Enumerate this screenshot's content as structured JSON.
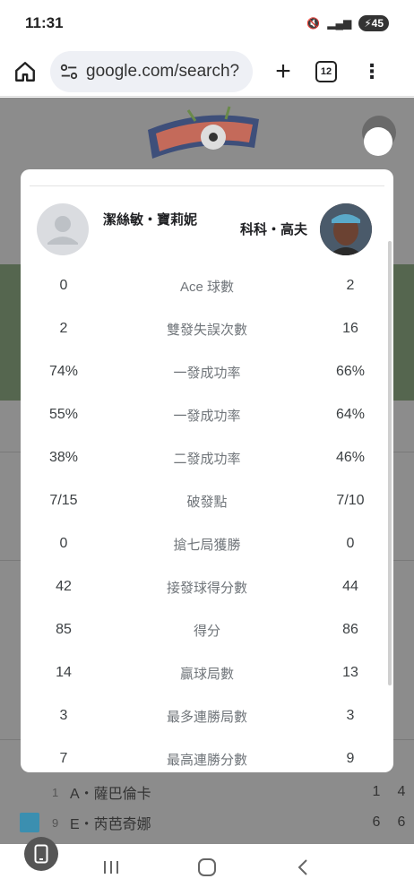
{
  "status_bar": {
    "time": "11:31",
    "battery": "45"
  },
  "browser": {
    "url": "google.com/search?",
    "tab_count": "12"
  },
  "background": {
    "list": [
      {
        "num": "1",
        "name": "A・薩巴倫卡",
        "s1": "1",
        "s2": "4"
      },
      {
        "num": "9",
        "name": "E・芮芭奇娜",
        "s1": "6",
        "s2": "6"
      }
    ]
  },
  "modal": {
    "player_left": "潔絲敏・寶莉妮",
    "player_right": "科科・高夫",
    "stats": [
      {
        "left": "0",
        "label": "Ace 球數",
        "right": "2"
      },
      {
        "left": "2",
        "label": "雙發失誤次數",
        "right": "16"
      },
      {
        "left": "74%",
        "label": "一發成功率",
        "right": "66%"
      },
      {
        "left": "55%",
        "label": "一發成功率",
        "right": "64%"
      },
      {
        "left": "38%",
        "label": "二發成功率",
        "right": "46%"
      },
      {
        "left": "7/15",
        "label": "破發點",
        "right": "7/10"
      },
      {
        "left": "0",
        "label": "搶七局獲勝",
        "right": "0"
      },
      {
        "left": "42",
        "label": "接發球得分數",
        "right": "44"
      },
      {
        "left": "85",
        "label": "得分",
        "right": "86"
      },
      {
        "left": "14",
        "label": "贏球局數",
        "right": "13"
      },
      {
        "left": "3",
        "label": "最多連勝局數",
        "right": "3"
      },
      {
        "left": "7",
        "label": "最高連勝分數",
        "right": "9"
      }
    ]
  }
}
